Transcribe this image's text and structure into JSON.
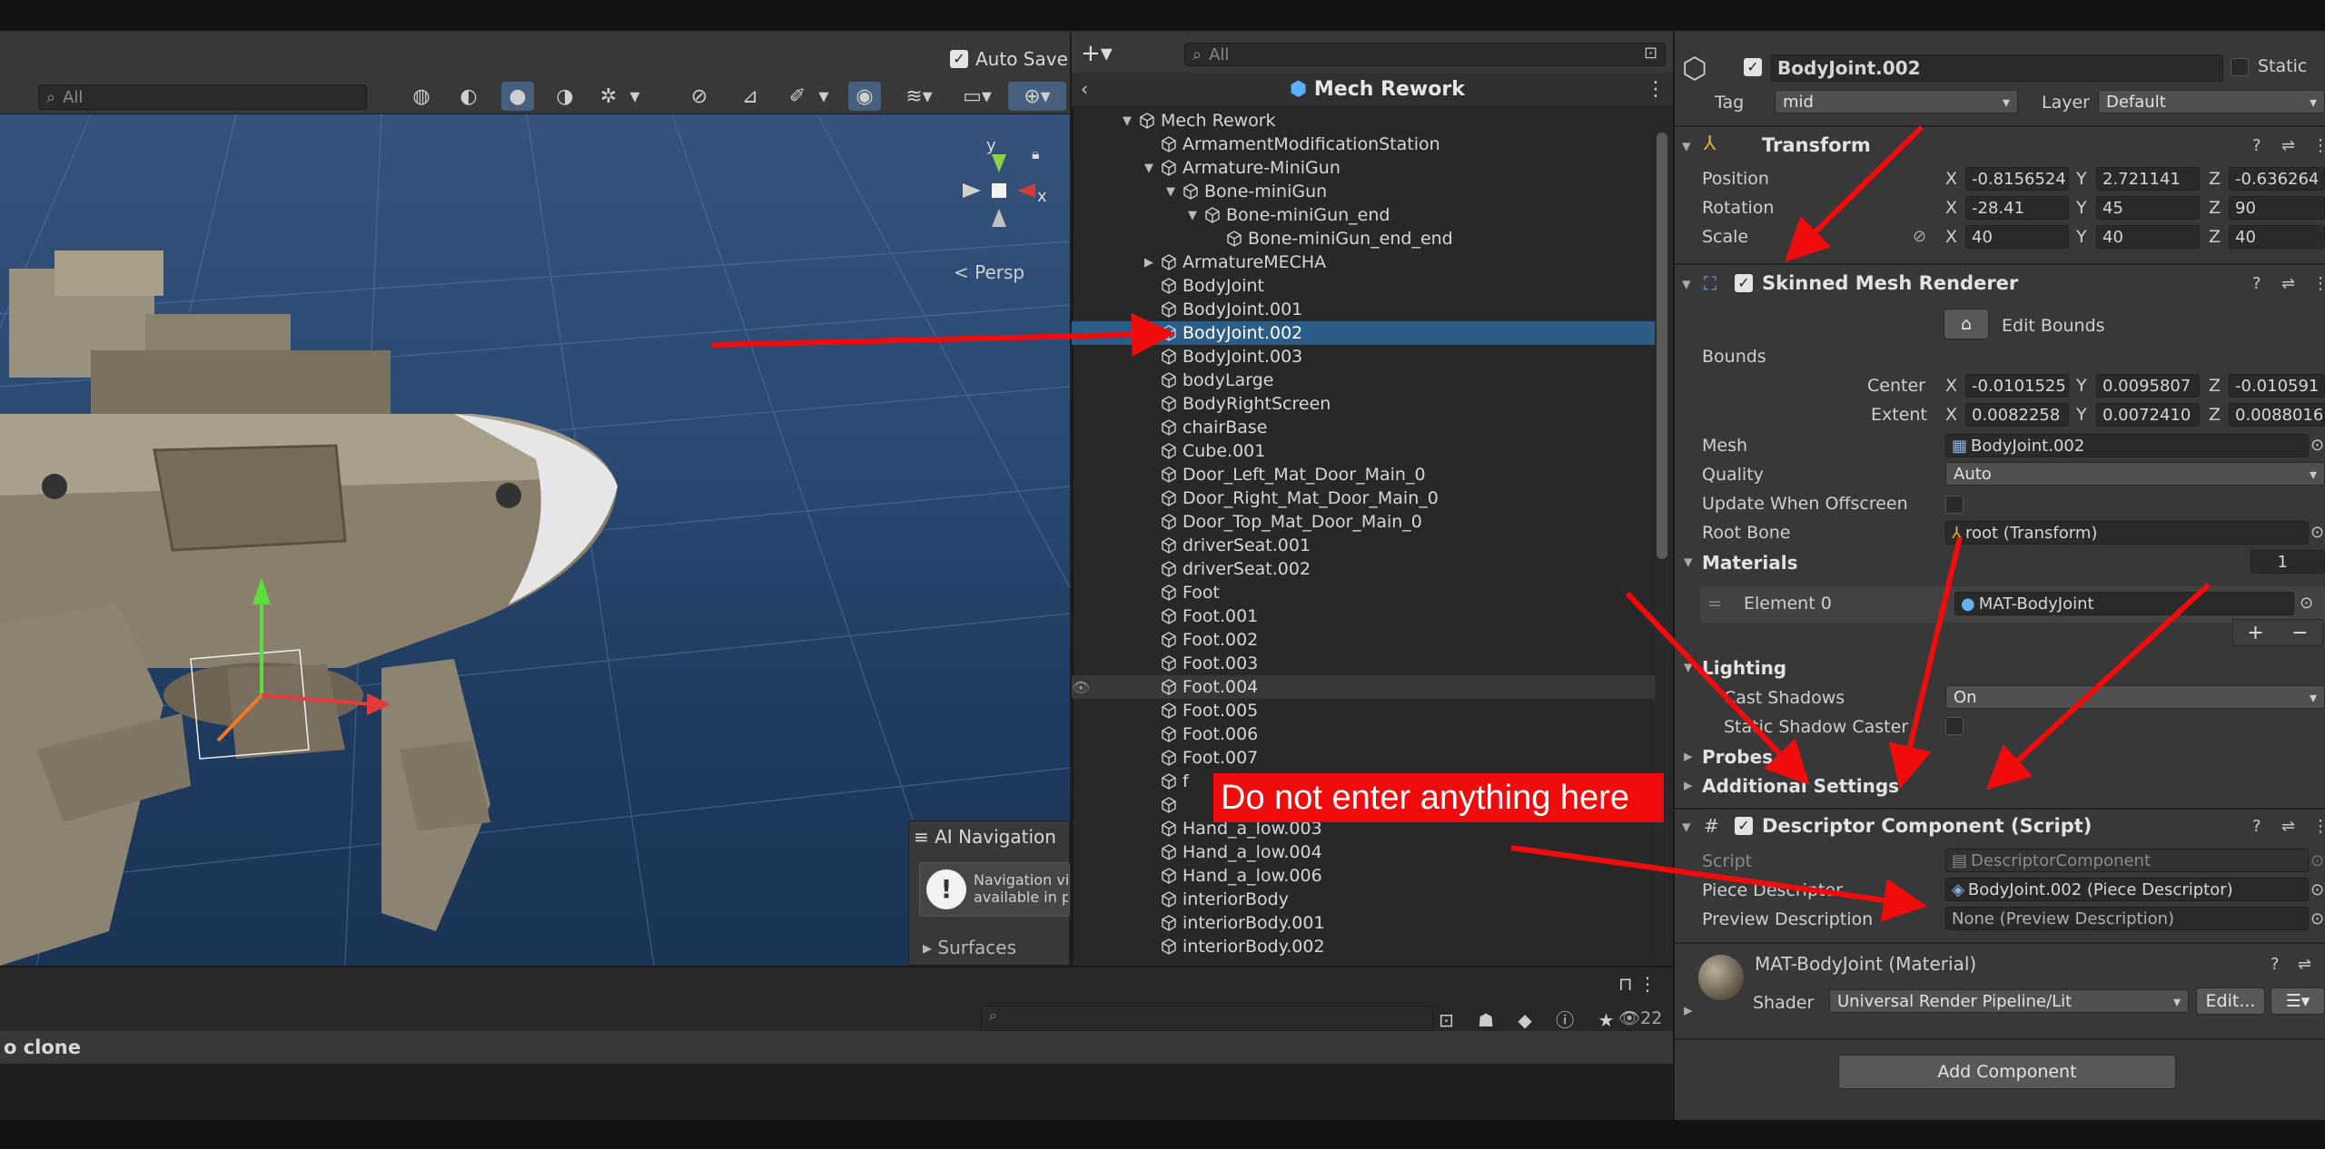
{
  "scene": {
    "autosave_label": "Auto Save",
    "search_placeholder": "All",
    "persp_label": "Persp",
    "gizmo_y": "y",
    "gizmo_x": "x",
    "ai_nav": {
      "title": "AI Navigation",
      "message_line1": "Navigation vis",
      "message_line2": "available in pr",
      "surfaces": "Surfaces"
    }
  },
  "hierarchy": {
    "search_placeholder": "All",
    "title": "Mech Rework",
    "rows": [
      {
        "label": "Mech Rework",
        "depth": 0,
        "fold": "open"
      },
      {
        "label": "ArmamentModificationStation",
        "depth": 1,
        "fold": "none"
      },
      {
        "label": "Armature-MiniGun",
        "depth": 1,
        "fold": "open"
      },
      {
        "label": "Bone-miniGun",
        "depth": 2,
        "fold": "open"
      },
      {
        "label": "Bone-miniGun_end",
        "depth": 3,
        "fold": "open"
      },
      {
        "label": "Bone-miniGun_end_end",
        "depth": 4,
        "fold": "none"
      },
      {
        "label": "ArmatureMECHA",
        "depth": 1,
        "fold": "closed"
      },
      {
        "label": "BodyJoint",
        "depth": 1,
        "fold": "none"
      },
      {
        "label": "BodyJoint.001",
        "depth": 1,
        "fold": "none"
      },
      {
        "label": "BodyJoint.002",
        "depth": 1,
        "fold": "none",
        "selected": true
      },
      {
        "label": "BodyJoint.003",
        "depth": 1,
        "fold": "none"
      },
      {
        "label": "bodyLarge",
        "depth": 1,
        "fold": "none"
      },
      {
        "label": "BodyRightScreen",
        "depth": 1,
        "fold": "none"
      },
      {
        "label": "chairBase",
        "depth": 1,
        "fold": "none"
      },
      {
        "label": "Cube.001",
        "depth": 1,
        "fold": "none"
      },
      {
        "label": "Door_Left_Mat_Door_Main_0",
        "depth": 1,
        "fold": "none"
      },
      {
        "label": "Door_Right_Mat_Door_Main_0",
        "depth": 1,
        "fold": "none"
      },
      {
        "label": "Door_Top_Mat_Door_Main_0",
        "depth": 1,
        "fold": "none"
      },
      {
        "label": "driverSeat.001",
        "depth": 1,
        "fold": "none"
      },
      {
        "label": "driverSeat.002",
        "depth": 1,
        "fold": "none"
      },
      {
        "label": "Foot",
        "depth": 1,
        "fold": "none"
      },
      {
        "label": "Foot.001",
        "depth": 1,
        "fold": "none"
      },
      {
        "label": "Foot.002",
        "depth": 1,
        "fold": "none"
      },
      {
        "label": "Foot.003",
        "depth": 1,
        "fold": "none"
      },
      {
        "label": "Foot.004",
        "depth": 1,
        "fold": "none",
        "hover": true
      },
      {
        "label": "Foot.005",
        "depth": 1,
        "fold": "none"
      },
      {
        "label": "Foot.006",
        "depth": 1,
        "fold": "none"
      },
      {
        "label": "Foot.007",
        "depth": 1,
        "fold": "none"
      },
      {
        "label": "f",
        "depth": 1,
        "fold": "none"
      },
      {
        "label": "",
        "depth": 1,
        "fold": "none"
      },
      {
        "label": "Hand_a_low.003",
        "depth": 1,
        "fold": "none"
      },
      {
        "label": "Hand_a_low.004",
        "depth": 1,
        "fold": "none"
      },
      {
        "label": "Hand_a_low.006",
        "depth": 1,
        "fold": "none"
      },
      {
        "label": "interiorBody",
        "depth": 1,
        "fold": "none"
      },
      {
        "label": "interiorBody.001",
        "depth": 1,
        "fold": "none"
      },
      {
        "label": "interiorBody.002",
        "depth": 1,
        "fold": "none"
      }
    ]
  },
  "bottom": {
    "clone_text": "o clone",
    "count_badge": "22"
  },
  "inspector": {
    "object_name": "BodyJoint.002",
    "static_label": "Static",
    "tag_label": "Tag",
    "tag_value": "mid",
    "layer_label": "Layer",
    "layer_value": "Default",
    "transform": {
      "title": "Transform",
      "position_label": "Position",
      "rotation_label": "Rotation",
      "scale_label": "Scale",
      "position": {
        "x": "-0.8156524",
        "y": "2.721141",
        "z": "-0.636264"
      },
      "rotation": {
        "x": "-28.41",
        "y": "45",
        "z": "90"
      },
      "scale": {
        "x": "40",
        "y": "40",
        "z": "40"
      }
    },
    "smr": {
      "title": "Skinned Mesh Renderer",
      "edit_bounds": "Edit Bounds",
      "bounds_label": "Bounds",
      "center_label": "Center",
      "extent_label": "Extent",
      "center": {
        "x": "-0.0101525",
        "y": "0.0095807",
        "z": "-0.010591"
      },
      "extent": {
        "x": "0.0082258",
        "y": "0.0072410",
        "z": "0.0088016"
      },
      "mesh_label": "Mesh",
      "mesh_value": "BodyJoint.002",
      "quality_label": "Quality",
      "quality_value": "Auto",
      "update_offscreen_label": "Update When Offscreen",
      "root_bone_label": "Root Bone",
      "root_bone_value": "root (Transform)",
      "materials_label": "Materials",
      "materials_count": "1",
      "element0_label": "Element 0",
      "element0_value": "MAT-BodyJoint",
      "lighting_label": "Lighting",
      "cast_shadows_label": "Cast Shadows",
      "cast_shadows_value": "On",
      "static_shadow_label": "Static Shadow Caster",
      "probes_label": "Probes",
      "additional_label": "Additional Settings"
    },
    "descriptor": {
      "title": "Descriptor Component (Script)",
      "script_label": "Script",
      "script_value": "DescriptorComponent",
      "piece_label": "Piece Descriptor",
      "piece_value": "BodyJoint.002 (Piece Descriptor)",
      "preview_label": "Preview Description",
      "preview_value": "None (Preview Description)"
    },
    "material": {
      "title": "MAT-BodyJoint (Material)",
      "shader_label": "Shader",
      "shader_value": "Universal Render Pipeline/Lit",
      "edit_label": "Edit..."
    },
    "add_component": "Add Component"
  },
  "annotation": {
    "warning": "Do not enter anything here"
  },
  "colors": {
    "selection": "#2c5d87",
    "annotation_red": "#f00c0c"
  }
}
